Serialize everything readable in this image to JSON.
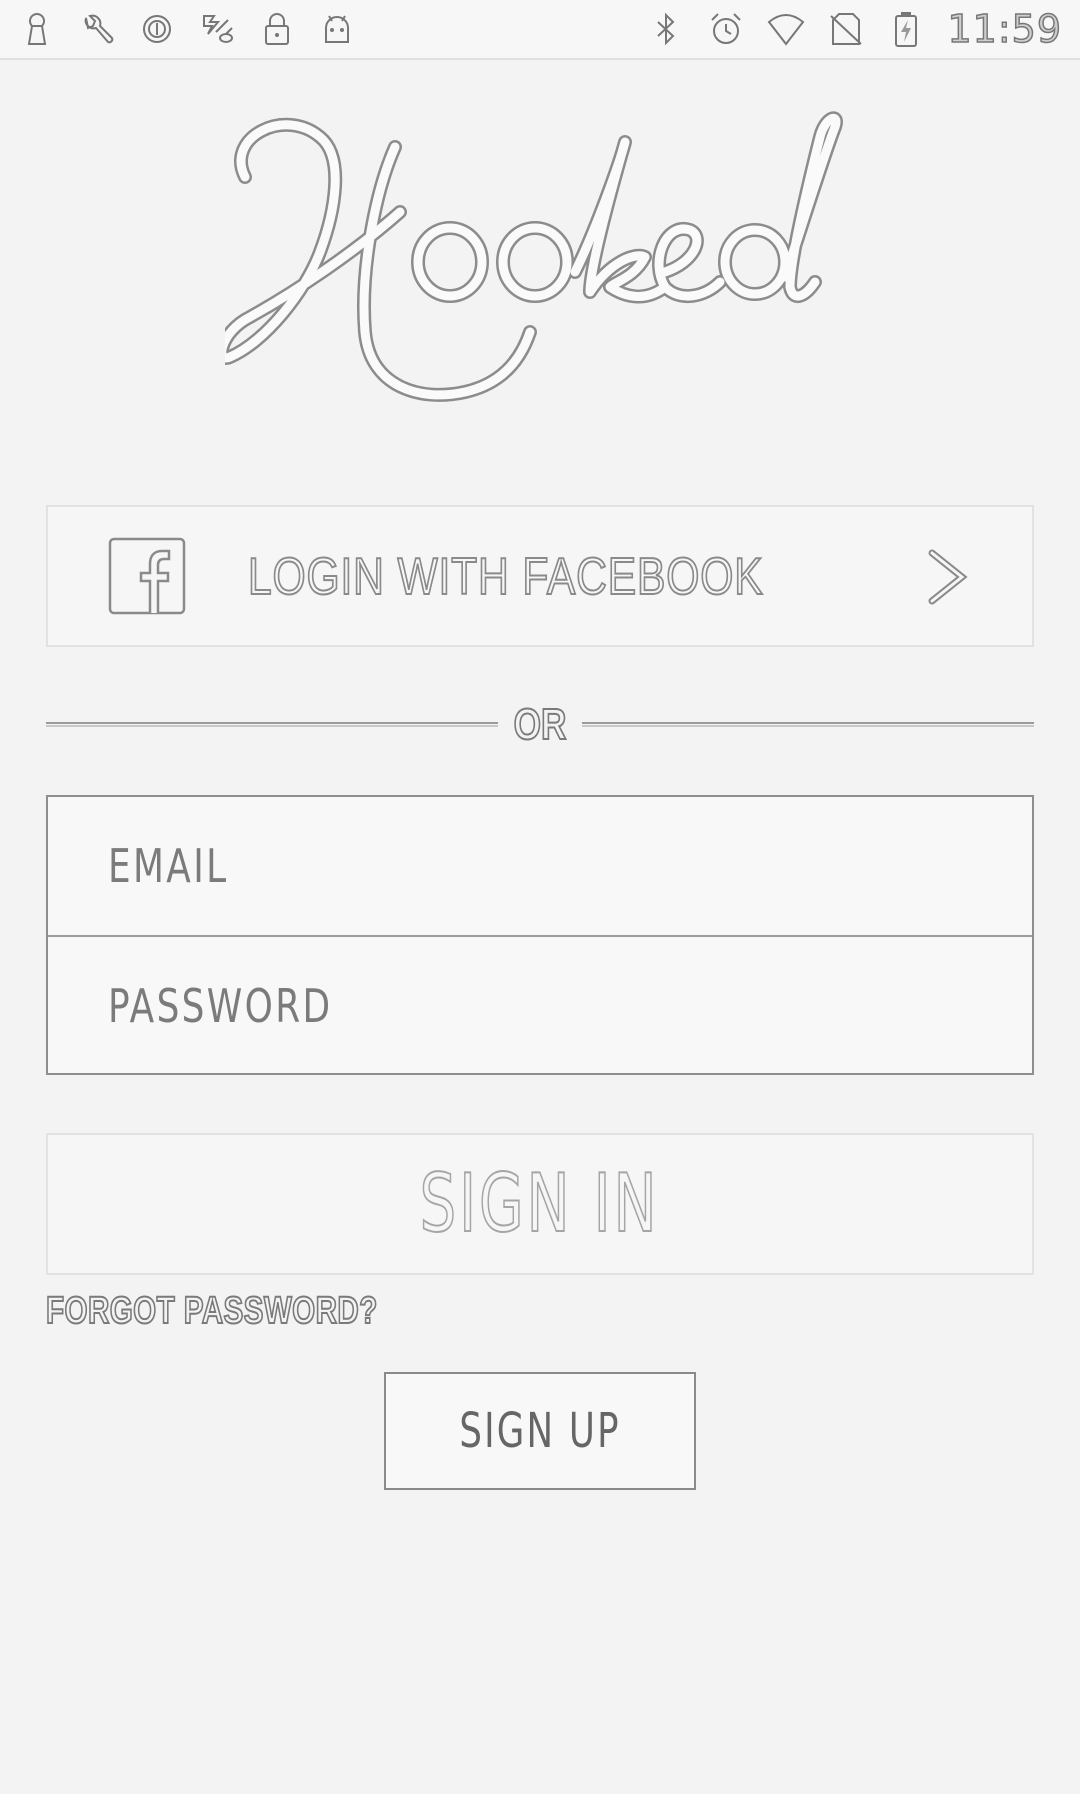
{
  "status_bar": {
    "left_icons": [
      "keyhole-icon",
      "wrench-icon",
      "circle-o-icon",
      "fan-icon",
      "lock-icon",
      "android-icon"
    ],
    "right_icons": [
      "bluetooth-icon",
      "alarm-icon",
      "wifi-icon",
      "no-sim-icon",
      "battery-charging-icon"
    ],
    "time": "11:59"
  },
  "logo": {
    "text": "Hooked"
  },
  "facebook_button": {
    "label": "LOGIN WITH FACEBOOK",
    "icon": "facebook-icon",
    "chevron": "chevron-right-icon"
  },
  "divider": {
    "label": "OR"
  },
  "form": {
    "email_placeholder": "EMAIL",
    "email_value": "",
    "password_placeholder": "PASSWORD",
    "password_value": ""
  },
  "sign_in": {
    "label": "SIGN IN"
  },
  "forgot_password": {
    "label": "FORGOT PASSWORD?"
  },
  "sign_up": {
    "label": "SIGN UP"
  },
  "colors": {
    "background": "#f3f3f3",
    "outline": "#8a8a8a"
  }
}
